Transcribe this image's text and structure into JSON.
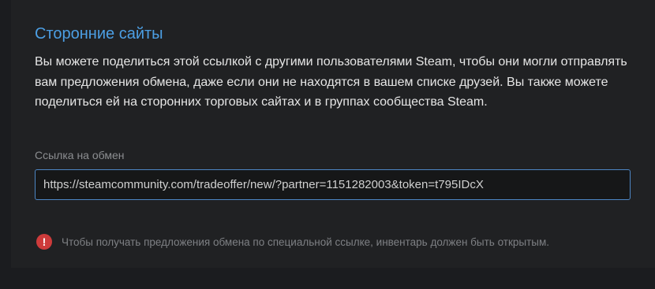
{
  "section": {
    "title": "Сторонние сайты",
    "description": "Вы можете поделиться этой ссылкой с другими пользователями Steam, чтобы они могли отправлять вам предложения обмена, даже если они не находятся в вашем списке друзей. Вы также можете поделиться ей на сторонних торговых сайтах и в группах сообщества Steam."
  },
  "trade_link": {
    "label": "Ссылка на обмен",
    "value": "https://steamcommunity.com/tradeoffer/new/?partner=1151282003&token=t795IDcX"
  },
  "notice": {
    "icon": "alert-icon",
    "icon_glyph": "!",
    "text": "Чтобы получать предложения обмена по специальной ссылке, инвентарь должен быть открытым."
  },
  "colors": {
    "accent": "#4c9fe4",
    "alert": "#cd3b3b",
    "input_border": "#4d86c4"
  }
}
